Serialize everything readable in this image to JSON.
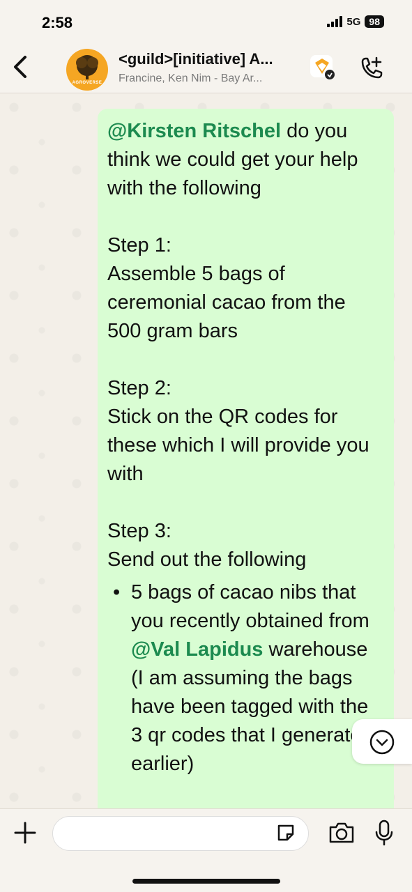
{
  "status_bar": {
    "time": "2:58",
    "network": "5G",
    "battery": "98"
  },
  "header": {
    "title": "<guild>[initiative] A...",
    "subtitle": "Francine, Ken Nim - Bay Ar...",
    "avatar_label": "AGROVERSE"
  },
  "message": {
    "mention_1": "@Kirsten Ritschel",
    "intro": " do you think we could get your help with the following",
    "step1_title": "Step 1:",
    "step1_text": "Assemble 5 bags of ceremonial cacao from the 500 gram bars",
    "step2_title": "Step 2:",
    "step2_text": "Stick on the QR codes for these which I will provide you with",
    "step3_title": "Step 3:",
    "step3_text": "Send out the following",
    "bullet1_a": "5 bags of cacao nibs that you recently obtained from ",
    "mention_2": "@Val Lapidus",
    "bullet1_b": " warehouse (I am assuming the bags have been tagged with the 3 qr codes that I generated earlier)"
  },
  "colors": {
    "bubble": "#d9fdd3",
    "mention": "#1c8a4f",
    "avatar": "#f5a623"
  },
  "icons": [
    "back-chevron-icon",
    "agroverse-logo",
    "app-badge-icon",
    "add-call-icon",
    "chevron-down-icon",
    "plus-icon",
    "sticker-icon",
    "camera-icon",
    "mic-icon"
  ]
}
